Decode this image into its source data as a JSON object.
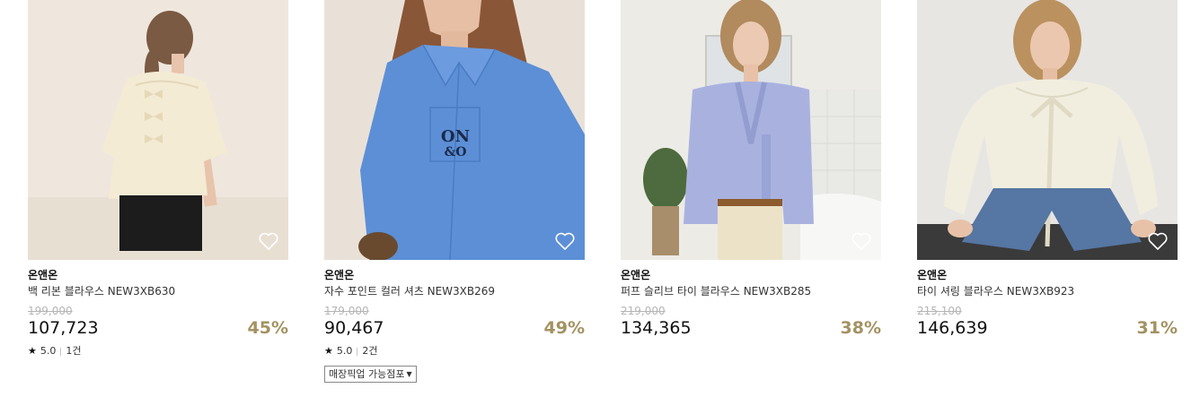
{
  "products": [
    {
      "brand": "온앤온",
      "name": "백 리본 블라우스 NEW3XB630",
      "original_price": "199,000",
      "price": "107,723",
      "discount": "45%",
      "rating": "5.0",
      "reviews": "1건",
      "favorite_icon": "heart-outline-icon"
    },
    {
      "brand": "온앤온",
      "name": "자수 포인트 컬러 셔츠 NEW3XB269",
      "original_price": "179,000",
      "price": "90,467",
      "discount": "49%",
      "rating": "5.0",
      "reviews": "2건",
      "pickup_label": "매장픽업 가능점포",
      "favorite_icon": "heart-outline-icon"
    },
    {
      "brand": "온앤온",
      "name": "퍼프 슬리브 타이 블라우스 NEW3XB285",
      "original_price": "219,000",
      "price": "134,365",
      "discount": "38%",
      "favorite_icon": "heart-outline-icon"
    },
    {
      "brand": "온앤온",
      "name": "타이 셔링 블라우스 NEW3XB923",
      "original_price": "215,100",
      "price": "146,639",
      "discount": "31%",
      "favorite_icon": "heart-outline-icon"
    }
  ],
  "colors": {
    "discount": "#a39262",
    "original_price": "#b5b5b5",
    "text": "#111111"
  }
}
